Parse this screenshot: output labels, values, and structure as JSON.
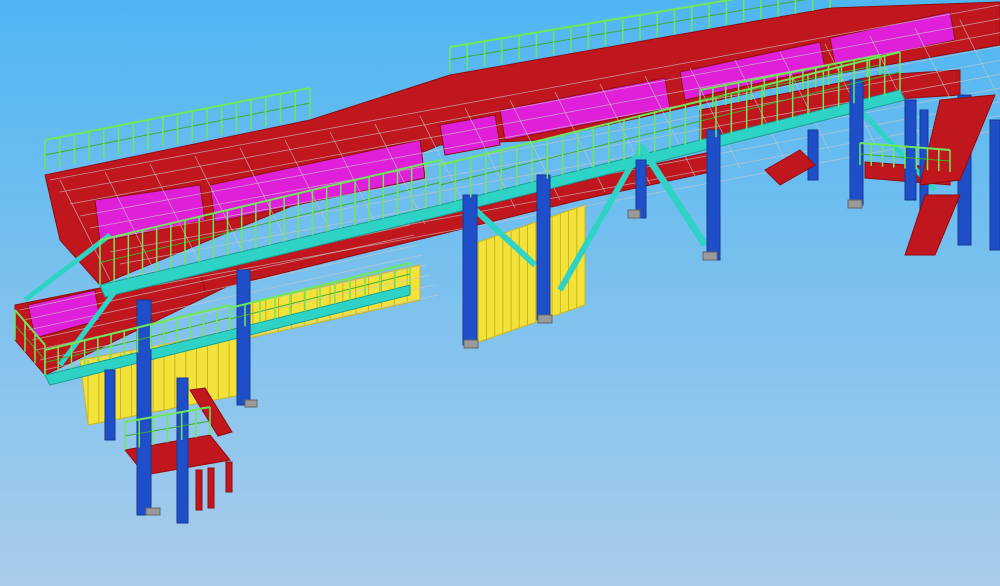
{
  "scene": {
    "subject": "steel-structure-3d-model",
    "colors": {
      "sky_top": "#4FB6F2",
      "sky_bottom": "#A9CCEA",
      "deck": "#C0161E",
      "deck_dark": "#8E0E12",
      "panel": "#E020D8",
      "railing": "#6EE85A",
      "railing_dark": "#3FAE2E",
      "beam": "#2FD3C6",
      "column": "#1F4FC8",
      "column_dark": "#173A94",
      "cladding": "#F2E23A",
      "cladding_dark": "#C9B622",
      "grating": "#C8C8C8",
      "base_plate": "#9A9A9A"
    }
  }
}
